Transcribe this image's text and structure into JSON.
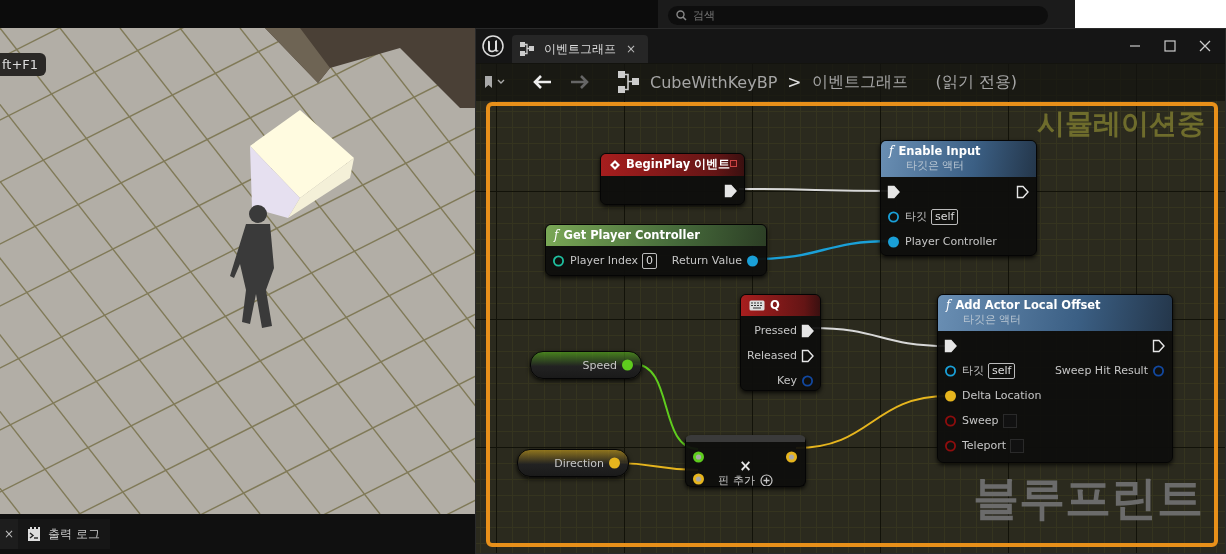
{
  "viewport": {
    "shortcut_hint": "ft+F1"
  },
  "bottom_bar": {
    "close": "×",
    "tabs": [
      {
        "label": "출력 로그"
      }
    ]
  },
  "details_panel": {
    "search": {
      "placeholder": "검색"
    }
  },
  "blueprint_window": {
    "tab": {
      "label": "이벤트그래프",
      "close": "×"
    },
    "breadcrumb": {
      "blueprint": "CubeWithKeyBP",
      "separator": ">",
      "graph": "이벤트그래프",
      "mode": "(읽기 전용)"
    },
    "overlay_top": "시뮬레이션중",
    "overlay_bottom": "블루프린트",
    "nodes": [
      {
        "kind": "event",
        "title": "BeginPlay 이벤트",
        "outputs": [
          {
            "kind": "exec",
            "connected": true
          }
        ]
      },
      {
        "kind": "function",
        "glyph": "f",
        "title": "Enable Input",
        "subtitle": "타깃은 액터",
        "inputs": [
          {
            "kind": "exec",
            "connected": true
          },
          {
            "kind": "object",
            "label": "타깃",
            "default": "self",
            "connected": false
          },
          {
            "kind": "object",
            "label": "Player Controller",
            "connected": true
          }
        ],
        "outputs": [
          {
            "kind": "exec",
            "connected": false
          }
        ]
      },
      {
        "kind": "pure_function",
        "glyph": "f",
        "title": "Get Player Controller",
        "inputs": [
          {
            "kind": "integer",
            "label": "Player Index",
            "default": "0",
            "connected": false
          }
        ],
        "outputs": [
          {
            "kind": "object",
            "label": "Return Value",
            "connected": true
          }
        ]
      },
      {
        "kind": "input_key",
        "title": "Q",
        "outputs": [
          {
            "kind": "exec",
            "label": "Pressed",
            "connected": true
          },
          {
            "kind": "exec",
            "label": "Released",
            "connected": false
          },
          {
            "kind": "struct",
            "label": "Key",
            "connected": false
          }
        ]
      },
      {
        "kind": "function",
        "glyph": "f",
        "title": "Add Actor Local Offset",
        "subtitle": "타깃은 액터",
        "inputs": [
          {
            "kind": "exec",
            "connected": true
          },
          {
            "kind": "object",
            "label": "타깃",
            "default": "self",
            "connected": false
          },
          {
            "kind": "vector",
            "label": "Delta Location",
            "connected": true
          },
          {
            "kind": "bool",
            "label": "Sweep",
            "checked": false,
            "connected": false
          },
          {
            "kind": "bool",
            "label": "Teleport",
            "checked": false,
            "connected": false
          }
        ],
        "outputs": [
          {
            "kind": "exec",
            "connected": false
          },
          {
            "kind": "struct",
            "label": "Sweep Hit Result",
            "connected": false
          }
        ]
      },
      {
        "kind": "variable",
        "outputs": [
          {
            "kind": "float",
            "label": "Speed",
            "connected": true
          }
        ]
      },
      {
        "kind": "variable",
        "outputs": [
          {
            "kind": "vector",
            "label": "Direction",
            "connected": true
          }
        ]
      },
      {
        "kind": "math",
        "symbol": "×",
        "add_pin": "핀 추가",
        "inputs": [
          {
            "kind": "float",
            "connected": true
          },
          {
            "kind": "vector",
            "connected": true
          }
        ],
        "outputs": [
          {
            "kind": "vector",
            "connected": true
          }
        ]
      }
    ]
  }
}
